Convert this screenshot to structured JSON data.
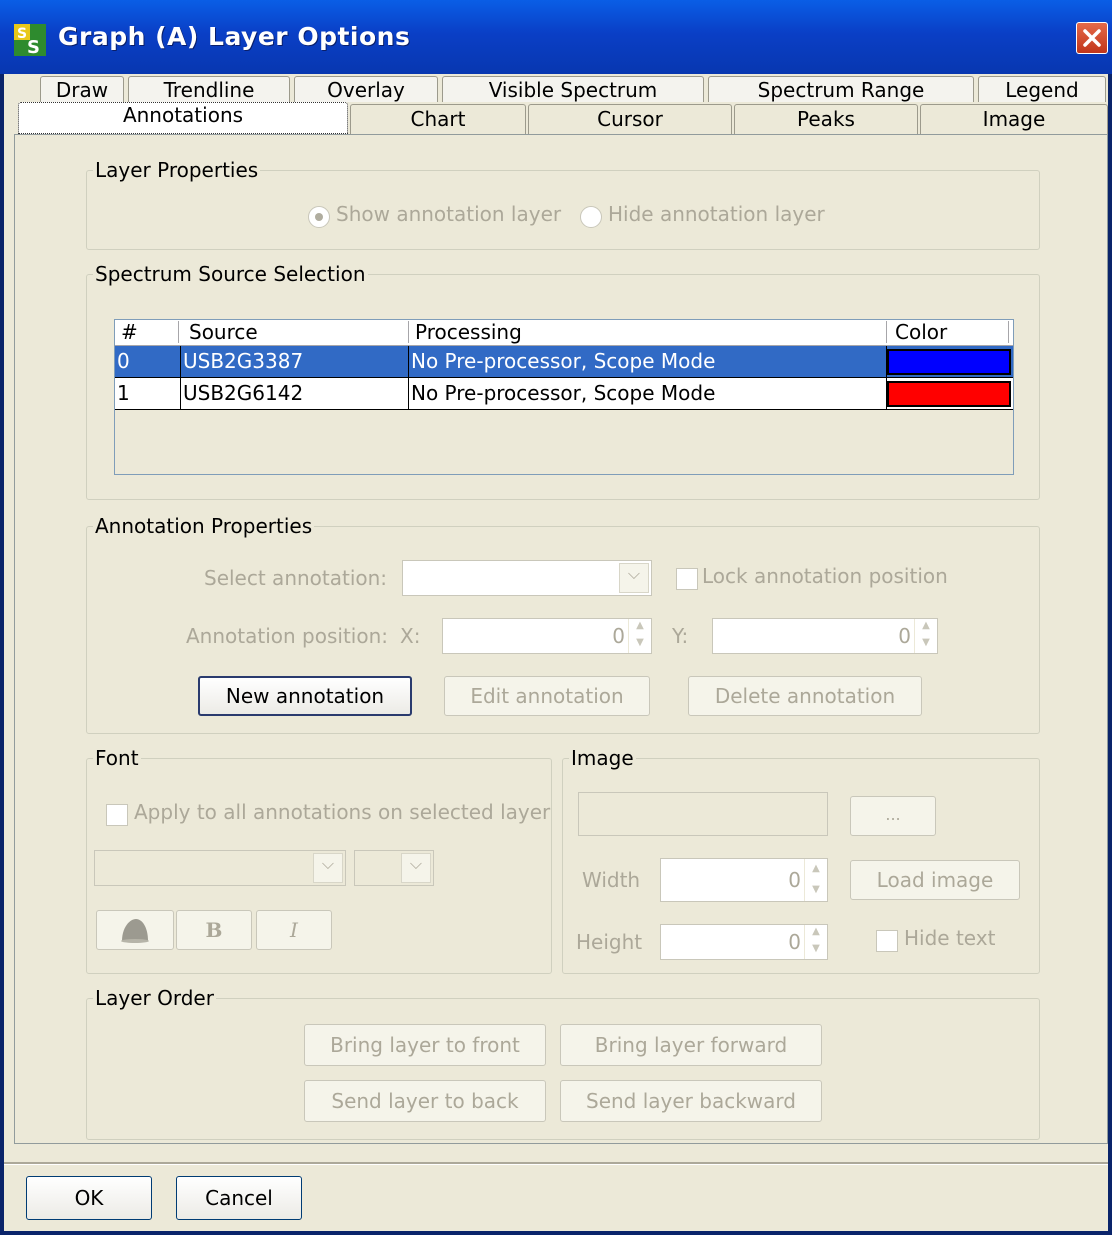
{
  "window": {
    "title": "Graph (A) Layer Options",
    "app_icon": "ss-app-icon",
    "close_icon": "close-icon"
  },
  "tabs": {
    "row1": [
      "Draw",
      "Trendline",
      "Overlay",
      "Visible Spectrum",
      "Spectrum Range",
      "Legend"
    ],
    "row2": [
      "Annotations",
      "Chart",
      "Cursor",
      "Peaks",
      "Image"
    ],
    "active": "Annotations"
  },
  "layer_properties": {
    "legend": "Layer Properties",
    "show_label": "Show annotation layer",
    "hide_label": "Hide annotation layer",
    "selected": "show"
  },
  "spectrum_source": {
    "legend": "Spectrum Source Selection",
    "columns": [
      "#",
      "Source",
      "Processing",
      "Color"
    ],
    "rows": [
      {
        "index": "0",
        "source": "USB2G3387",
        "processing": "No Pre-processor, Scope Mode",
        "color": "#0000ff",
        "selected": true
      },
      {
        "index": "1",
        "source": "USB2G6142",
        "processing": "No Pre-processor, Scope Mode",
        "color": "#ff0000",
        "selected": false
      }
    ]
  },
  "annotation_properties": {
    "legend": "Annotation Properties",
    "select_label": "Select annotation:",
    "lock_label": "Lock annotation position",
    "position_label": "Annotation position:",
    "x_label": "X:",
    "x_value": "0",
    "y_label": "Y:",
    "y_value": "0",
    "new_button": "New annotation",
    "edit_button": "Edit annotation",
    "delete_button": "Delete annotation"
  },
  "font": {
    "legend": "Font",
    "apply_label": "Apply to all annotations on selected layer",
    "bold_label": "B",
    "italic_label": "I",
    "color_icon": "font-color-icon"
  },
  "image": {
    "legend": "Image",
    "browse_button": "...",
    "width_label": "Width",
    "width_value": "0",
    "height_label": "Height",
    "height_value": "0",
    "load_button": "Load image",
    "hide_text_label": "Hide text"
  },
  "layer_order": {
    "legend": "Layer Order",
    "bring_front": "Bring layer to front",
    "bring_forward": "Bring layer forward",
    "send_back": "Send layer to back",
    "send_backward": "Send layer backward"
  },
  "footer": {
    "ok": "OK",
    "cancel": "Cancel"
  }
}
